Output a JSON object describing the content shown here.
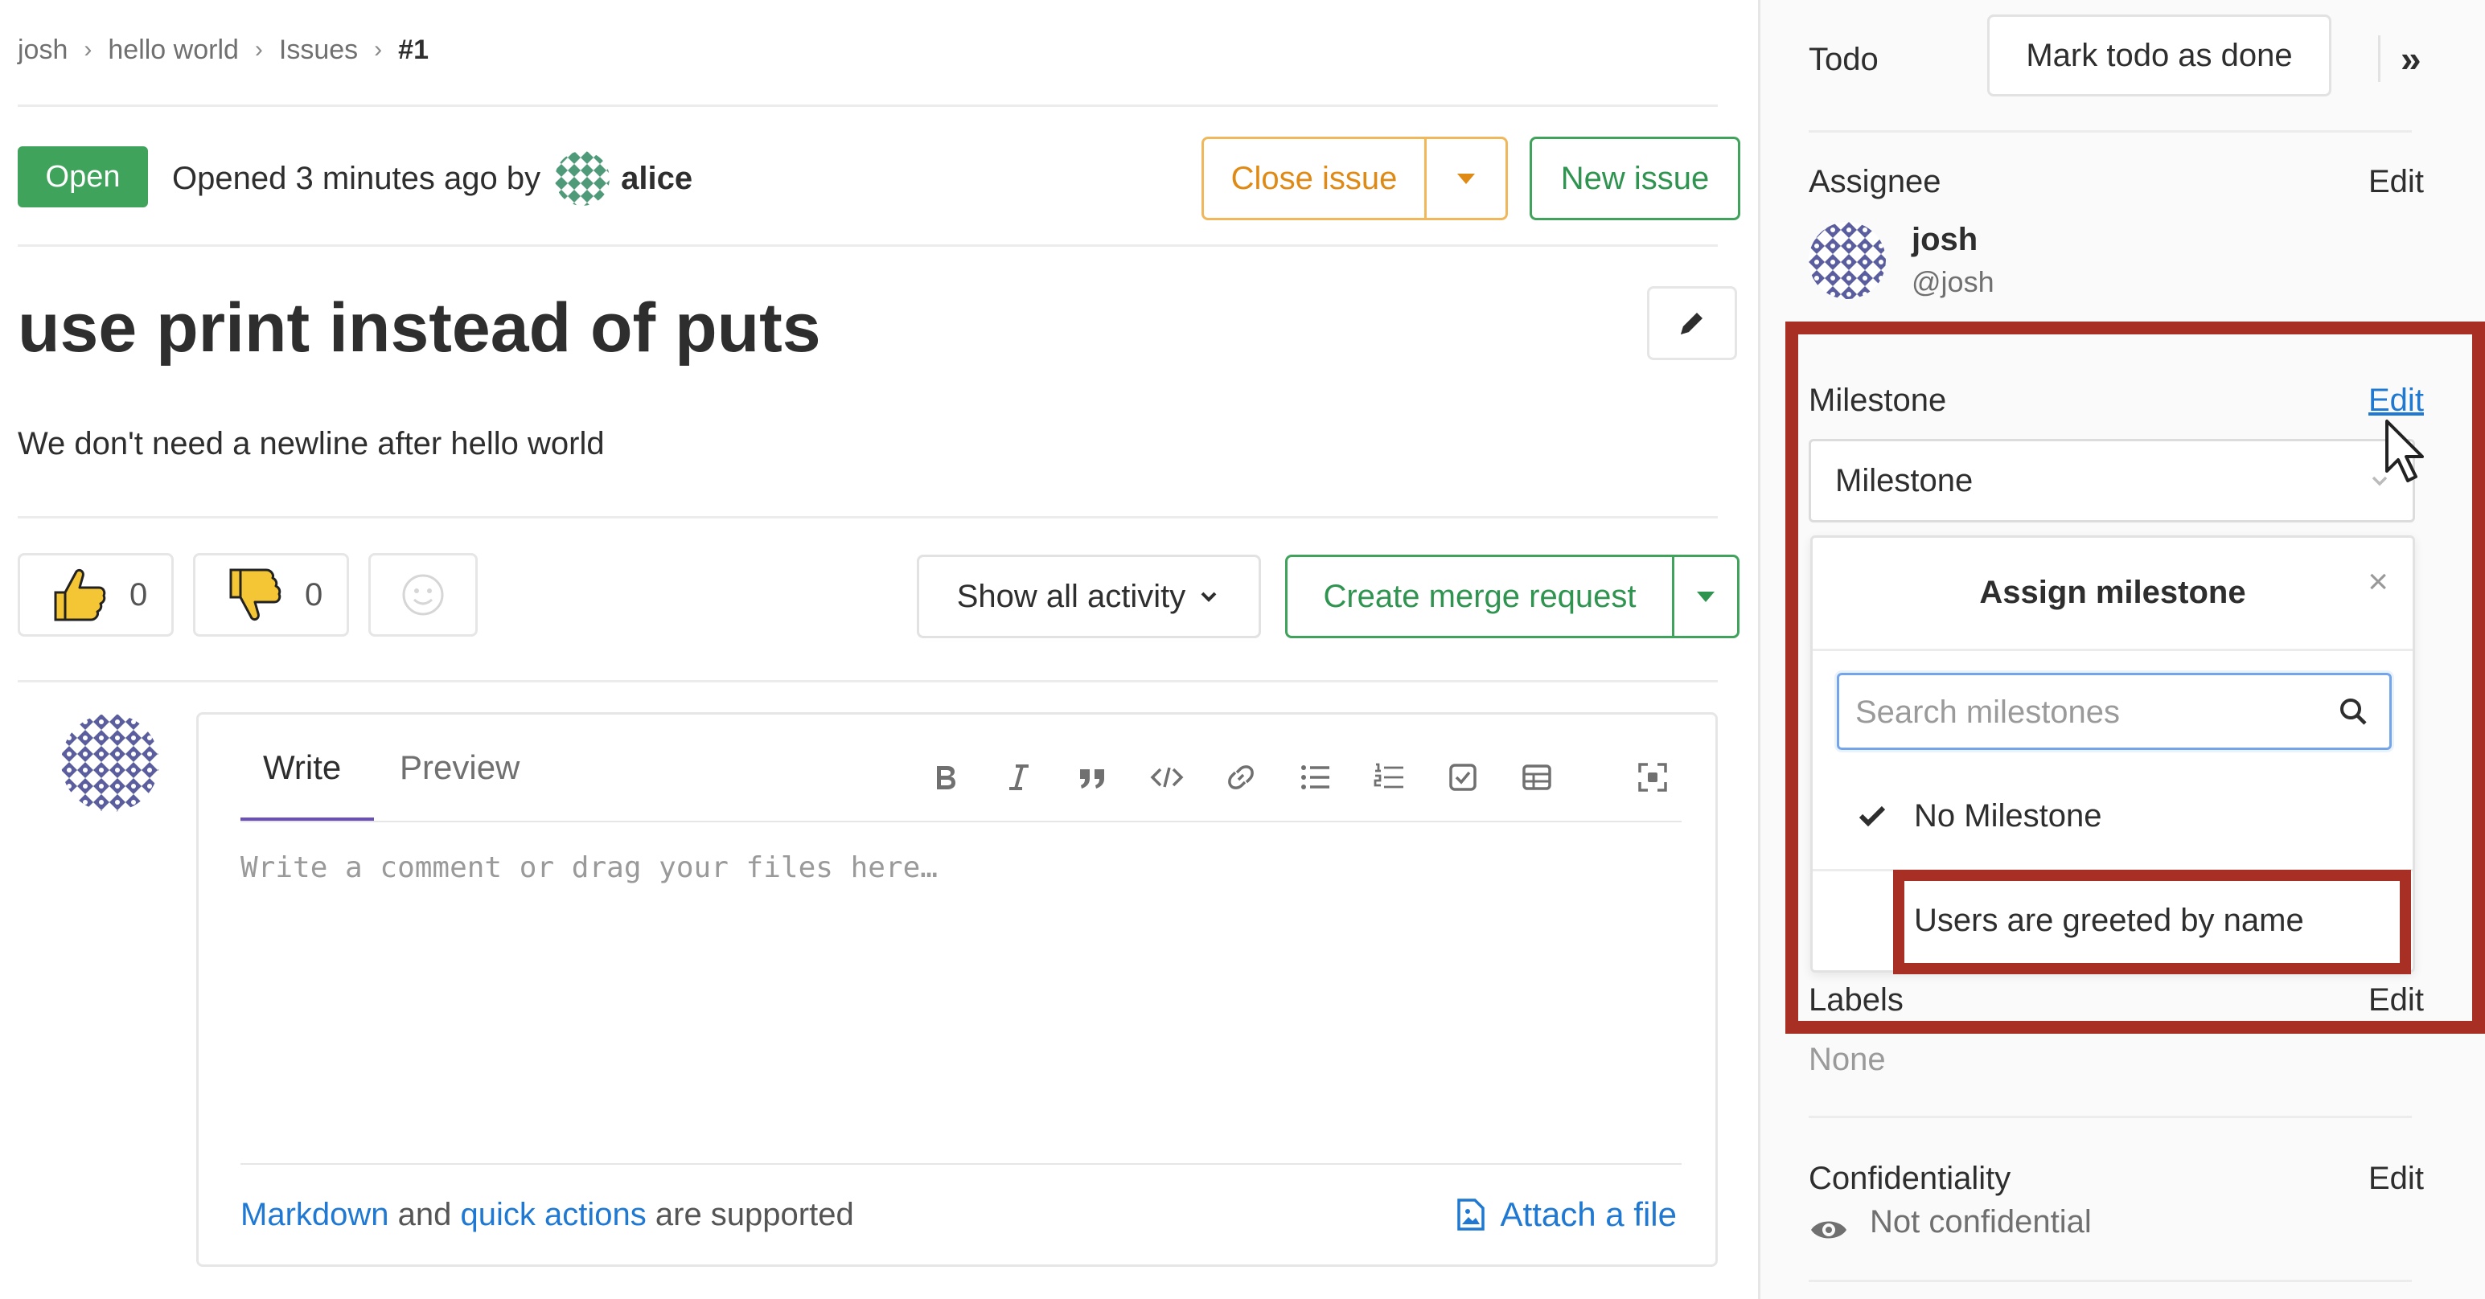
{
  "breadcrumb": {
    "items": [
      "josh",
      "hello world",
      "Issues"
    ],
    "current": "#1",
    "separator": "›"
  },
  "issue": {
    "status": "Open",
    "opened_prefix": "Opened 3 minutes ago by",
    "author": "alice",
    "title": "use print instead of puts",
    "description": "We don't need a newline after hello world"
  },
  "header_actions": {
    "close_issue": "Close issue",
    "new_issue": "New issue"
  },
  "awards": {
    "thumbs_up_count": "0",
    "thumbs_down_count": "0"
  },
  "activity": {
    "filter_label": "Show all activity",
    "create_mr": "Create merge request"
  },
  "comment": {
    "tab_write": "Write",
    "tab_preview": "Preview",
    "placeholder": "Write a comment or drag your files here…",
    "footer_markdown": "Markdown",
    "footer_and": "and",
    "footer_quick_actions": "quick actions",
    "footer_supported": "are supported",
    "attach_file": "Attach a file"
  },
  "sidebar": {
    "todo_label": "Todo",
    "todo_button": "Mark todo as done",
    "collapse_icon": "»",
    "assignee_label": "Assignee",
    "assignee_edit": "Edit",
    "assignee_name": "josh",
    "assignee_handle": "@josh",
    "milestone_label": "Milestone",
    "milestone_edit": "Edit",
    "milestone_select_value": "Milestone",
    "labels_label": "Labels",
    "labels_edit": "Edit",
    "labels_value": "None",
    "confidentiality_label": "Confidentiality",
    "confidentiality_edit": "Edit",
    "confidentiality_value": "Not confidential"
  },
  "milestone_dropdown": {
    "title": "Assign milestone",
    "close_icon": "×",
    "search_placeholder": "Search milestones",
    "items": [
      {
        "label": "No Milestone",
        "checked": true
      },
      {
        "label": "Users are greeted by name",
        "checked": false
      }
    ]
  },
  "colors": {
    "open_green": "#3fa35b",
    "warning_orange": "#e08a16",
    "link_blue": "#1f78d1",
    "annotation_red": "#a82f24",
    "tab_purple": "#6b4fbb"
  }
}
